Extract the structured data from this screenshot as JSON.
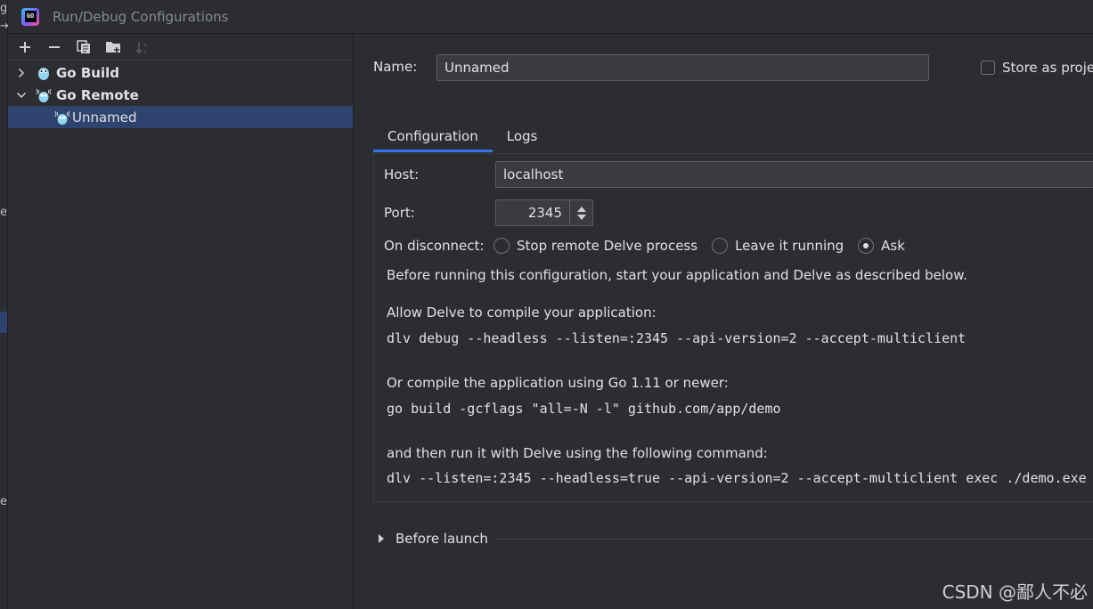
{
  "window": {
    "title": "Run/Debug Configurations",
    "logo_text": "GO"
  },
  "toolbar": {
    "add_icon": "plus-icon",
    "remove_icon": "minus-icon",
    "copy_icon": "copy-icon",
    "folder_icon": "new-folder-icon",
    "sort_icon": "sort-alpha-icon"
  },
  "tree": {
    "items": [
      {
        "label": "Go Build",
        "expanded": false,
        "icon": "go-build-icon"
      },
      {
        "label": "Go Remote",
        "expanded": true,
        "icon": "go-remote-icon"
      },
      {
        "label": "Unnamed",
        "selected": true,
        "icon": "go-remote-config-icon"
      }
    ]
  },
  "form": {
    "name_label": "Name:",
    "name_value": "Unnamed",
    "store_label": "Store as proje",
    "store_checked": false
  },
  "tabs": [
    {
      "label": "Configuration",
      "active": true
    },
    {
      "label": "Logs",
      "active": false
    }
  ],
  "config": {
    "host_label": "Host:",
    "host_value": "localhost",
    "port_label": "Port:",
    "port_value": "2345",
    "disconnect_label": "On disconnect:",
    "disconnect_options": [
      {
        "label": "Stop remote Delve process",
        "checked": false
      },
      {
        "label": "Leave it running",
        "checked": false
      },
      {
        "label": "Ask",
        "checked": true
      }
    ],
    "intro": "Before running this configuration, start your application and Delve as described below.",
    "allow_text": "Allow Delve to compile your application:",
    "allow_cmd": "dlv debug --headless --listen=:2345 --api-version=2 --accept-multiclient",
    "compile_text": "Or compile the application using Go 1.11 or newer:",
    "compile_cmd": "go build -gcflags \"all=-N -l\" github.com/app/demo",
    "run_text": "and then run it with Delve using the following command:",
    "run_cmd": "dlv --listen=:2345 --headless=true --api-version=2 --accept-multiclient exec ./demo.exe"
  },
  "before_launch": {
    "label": "Before launch"
  },
  "watermark": "CSDN @鄙人不必",
  "colors": {
    "background": "#2b2d30",
    "selection": "#2e436e",
    "accent": "#3574f0",
    "field": "#393b40"
  }
}
